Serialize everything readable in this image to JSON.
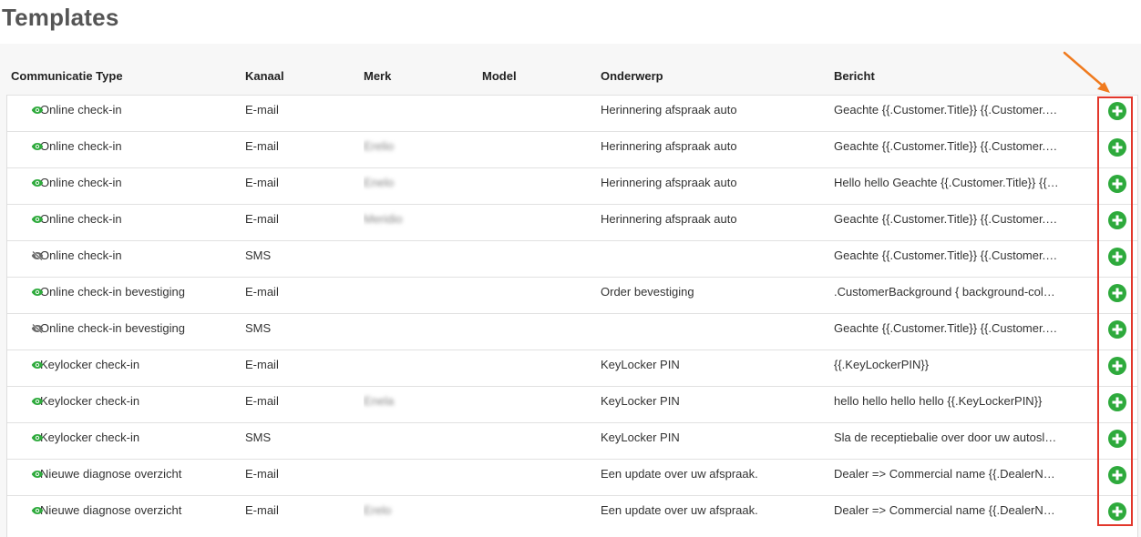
{
  "page_title": "Templates",
  "columns": {
    "communicatie_type": "Communicatie Type",
    "kanaal": "Kanaal",
    "merk": "Merk",
    "model": "Model",
    "onderwerp": "Onderwerp",
    "bericht": "Bericht"
  },
  "rows": [
    {
      "visible": true,
      "type": "Online check-in",
      "kanaal": "E-mail",
      "merk": "",
      "model": "",
      "onderwerp": "Herinnering afspraak auto",
      "bericht": "Geachte {{.Customer.Title}} {{.Customer.Sur..."
    },
    {
      "visible": true,
      "type": "Online check-in",
      "kanaal": "E-mail",
      "merk": "Erelio",
      "model": "",
      "onderwerp": "Herinnering afspraak auto",
      "bericht": "Geachte {{.Customer.Title}} {{.Customer.Sur..."
    },
    {
      "visible": true,
      "type": "Online check-in",
      "kanaal": "E-mail",
      "merk": "Enelo",
      "model": "",
      "onderwerp": "Herinnering afspraak auto",
      "bericht": "Hello hello Geachte {{.Customer.Title}} {{.C..."
    },
    {
      "visible": true,
      "type": "Online check-in",
      "kanaal": "E-mail",
      "merk": "Meridio",
      "model": "",
      "onderwerp": "Herinnering afspraak auto",
      "bericht": "Geachte {{.Customer.Title}} {{.Customer.Sur..."
    },
    {
      "visible": false,
      "type": "Online check-in",
      "kanaal": "SMS",
      "merk": "",
      "model": "",
      "onderwerp": "",
      "bericht": "Geachte {{.Customer.Title}} {{.Customer.Fir..."
    },
    {
      "visible": true,
      "type": "Online check-in bevestiging",
      "kanaal": "E-mail",
      "merk": "",
      "model": "",
      "onderwerp": "Order bevestiging",
      "bericht": ".CustomerBackground { background-color: ..."
    },
    {
      "visible": false,
      "type": "Online check-in bevestiging",
      "kanaal": "SMS",
      "merk": "",
      "model": "",
      "onderwerp": "",
      "bericht": "Geachte {{.Customer.Title}} {{.Customer.Fir..."
    },
    {
      "visible": true,
      "type": "Keylocker check-in",
      "kanaal": "E-mail",
      "merk": "",
      "model": "",
      "onderwerp": "KeyLocker PIN",
      "bericht": "{{.KeyLockerPIN}}"
    },
    {
      "visible": true,
      "type": "Keylocker check-in",
      "kanaal": "E-mail",
      "merk": "Enela",
      "model": "",
      "onderwerp": "KeyLocker PIN",
      "bericht": "hello hello hello hello {{.KeyLockerPIN}}"
    },
    {
      "visible": true,
      "type": "Keylocker check-in",
      "kanaal": "SMS",
      "merk": "",
      "model": "",
      "onderwerp": "KeyLocker PIN",
      "bericht": "Sla de receptiebalie over door uw autosleu..."
    },
    {
      "visible": true,
      "type": "Nieuwe diagnose overzicht",
      "kanaal": "E-mail",
      "merk": "",
      "model": "",
      "onderwerp": "Een update over uw afspraak.",
      "bericht": "Dealer => Commercial name {{.DealerNam..."
    },
    {
      "visible": true,
      "type": "Nieuwe diagnose overzicht",
      "kanaal": "E-mail",
      "merk": "Erelo",
      "model": "",
      "onderwerp": "Een update over uw afspraak.",
      "bericht": "Dealer => Commercial name {{.DealerNam..."
    }
  ],
  "colors": {
    "accent_green": "#2eaa3c",
    "eye_green": "#2eaa3c",
    "eye_hidden": "#666666",
    "highlight_red": "#e2372b",
    "arrow_orange": "#f07b1f"
  },
  "icons": {
    "visible": "eye-icon",
    "hidden": "eye-slash-icon",
    "add": "plus-circle-icon"
  }
}
